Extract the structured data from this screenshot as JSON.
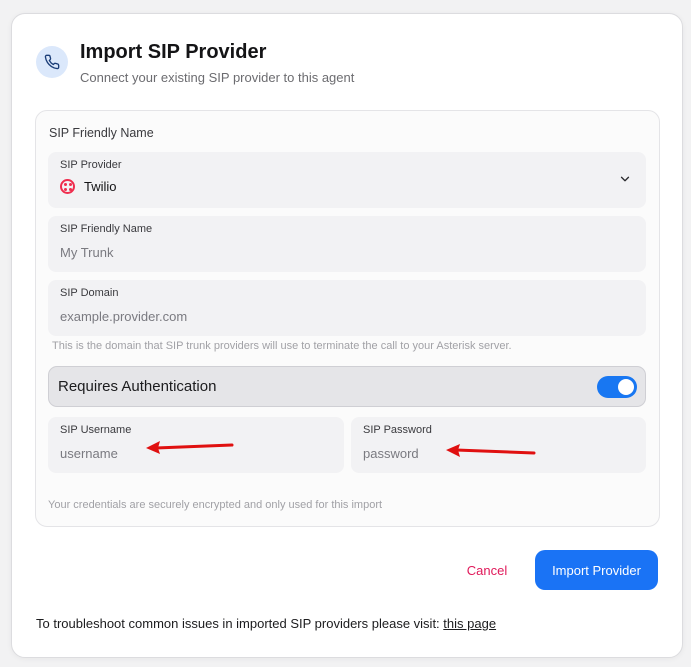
{
  "header": {
    "icon": "phone-icon",
    "title": "Import SIP Provider",
    "subtitle": "Connect your existing SIP provider to this agent"
  },
  "form": {
    "section_label": "SIP Friendly Name",
    "provider": {
      "label": "SIP Provider",
      "value": "Twilio",
      "icon": "twilio-logo",
      "dropdown_icon": "chevron-down-icon"
    },
    "friendly_name": {
      "label": "SIP Friendly Name",
      "placeholder": "My Trunk"
    },
    "domain": {
      "label": "SIP Domain",
      "placeholder": "example.provider.com"
    },
    "domain_hint": "This is the domain that SIP trunk providers will use to terminate the call to your Asterisk server.",
    "auth": {
      "label": "Requires Authentication",
      "enabled": true
    },
    "username": {
      "label": "SIP Username",
      "placeholder": "username"
    },
    "password": {
      "label": "SIP Password",
      "placeholder": "password"
    },
    "credentials_note": "Your credentials are securely encrypted and only used for this import"
  },
  "actions": {
    "cancel_label": "Cancel",
    "import_label": "Import Provider"
  },
  "footer": {
    "text": "To troubleshoot common issues in imported SIP providers please visit: ",
    "link_label": "this page"
  },
  "colors": {
    "accent": "#1a73f5",
    "cancel": "#e0195a",
    "twilio": "#ef2d4e",
    "annotation_arrow": "#e01010"
  }
}
